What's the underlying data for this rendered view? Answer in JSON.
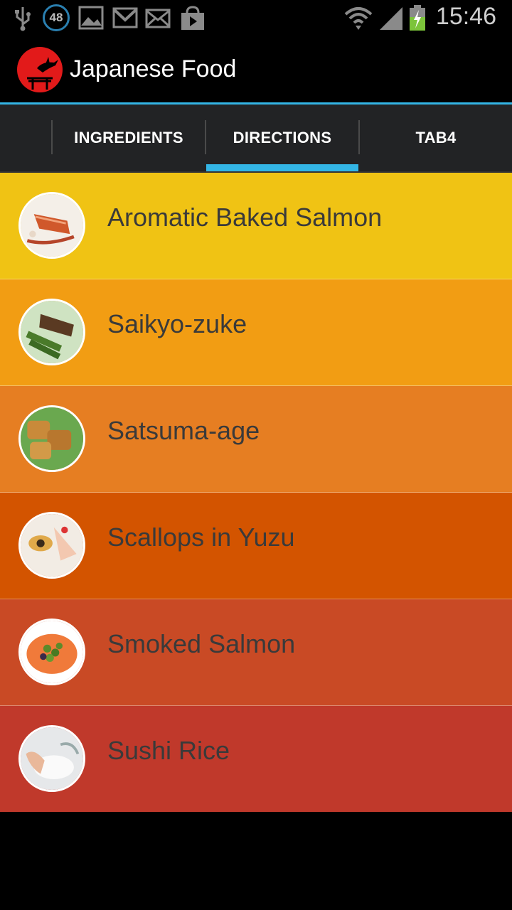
{
  "status_bar": {
    "time": "15:46",
    "notification_badge": "48",
    "icons": [
      "usb-icon",
      "badge-48-icon",
      "image-icon",
      "gmail-icon",
      "email-icon",
      "play-store-icon",
      "wifi-icon",
      "signal-icon",
      "battery-charging-icon"
    ]
  },
  "action_bar": {
    "title": "Japanese Food",
    "logo_icon": "torii-crane-logo-icon"
  },
  "tabs": [
    {
      "label": "INGREDIENTS",
      "selected": false
    },
    {
      "label": "DIRECTIONS",
      "selected": true
    },
    {
      "label": "TAB4",
      "selected": false
    }
  ],
  "colors": {
    "accent": "#33b5e5",
    "row_colors": [
      "#f0c314",
      "#f29d13",
      "#e67e22",
      "#d35400",
      "#c94a25",
      "#c0392b"
    ]
  },
  "recipes": [
    {
      "name": "Aromatic Baked Salmon",
      "thumb": "baked-salmon-thumb-icon"
    },
    {
      "name": "Saikyo-zuke",
      "thumb": "saikyo-zuke-thumb-icon"
    },
    {
      "name": "Satsuma-age",
      "thumb": "satsuma-age-thumb-icon"
    },
    {
      "name": "Scallops in Yuzu",
      "thumb": "scallops-thumb-icon"
    },
    {
      "name": "Smoked Salmon",
      "thumb": "smoked-salmon-thumb-icon"
    },
    {
      "name": "Sushi Rice",
      "thumb": "sushi-rice-thumb-icon"
    }
  ]
}
